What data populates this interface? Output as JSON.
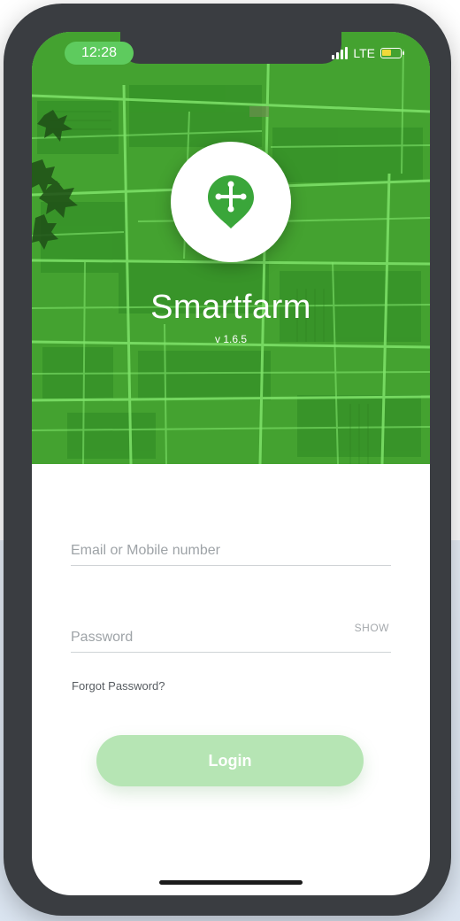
{
  "status_bar": {
    "time": "12:28",
    "network": "LTE",
    "icons": [
      "signal-bars-icon",
      "battery-icon"
    ]
  },
  "hero": {
    "logo_icon": "map-pin-crosshair-icon",
    "app_name": "Smartfarm",
    "version": "v 1.6.5"
  },
  "login_form": {
    "email_placeholder": "Email or Mobile number",
    "password_placeholder": "Password",
    "show_label": "SHOW",
    "forgot_password": "Forgot Password?",
    "login_label": "Login"
  },
  "colors": {
    "brand_green": "#3aa63a",
    "time_pill": "#5ecb5e",
    "login_button": "#b6e5b4",
    "field_border": "#cfd3d6"
  }
}
